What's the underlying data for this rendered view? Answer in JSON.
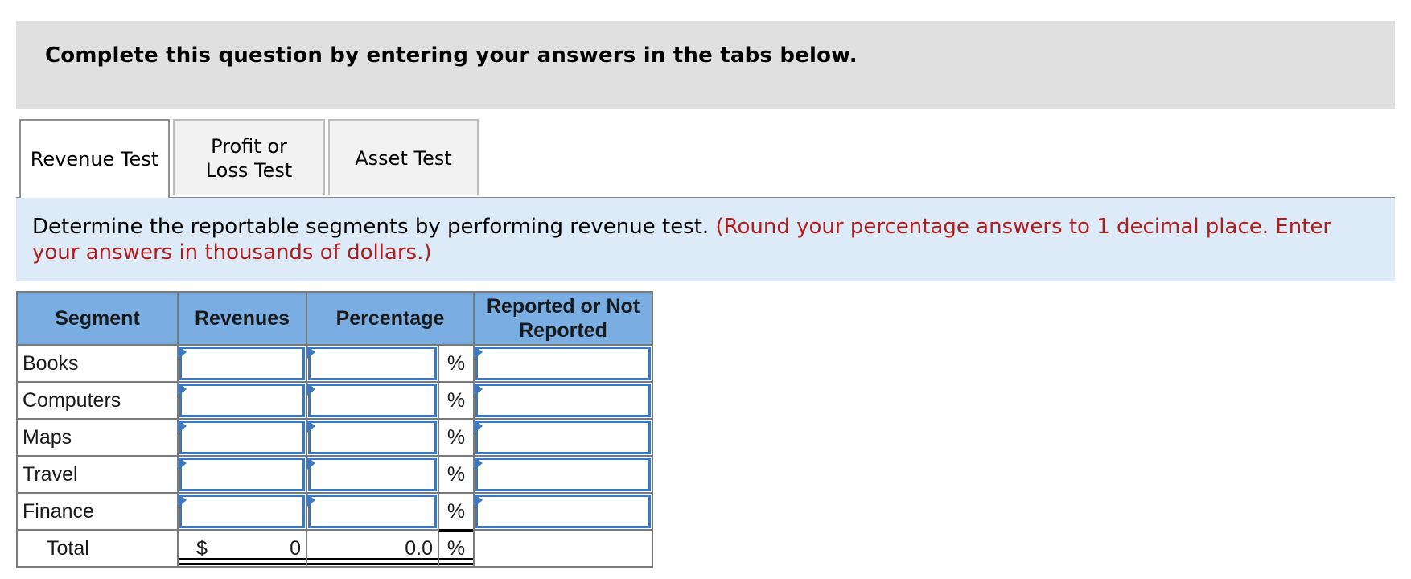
{
  "banner": {
    "text": "Complete this question by entering your answers in the tabs below."
  },
  "tabs": [
    {
      "label": "Revenue Test",
      "active": true
    },
    {
      "label": "Profit or Loss Test",
      "active": false
    },
    {
      "label": "Asset Test",
      "active": false
    }
  ],
  "instructions": {
    "main": "Determine the reportable segments by performing revenue test.",
    "note": "(Round your percentage answers to 1 decimal place. Enter your answers in thousands of dollars.)"
  },
  "table": {
    "headers": {
      "segment": "Segment",
      "revenues": "Revenues",
      "percentage": "Percentage",
      "reported": "Reported or Not Reported"
    },
    "percent_symbol": "%",
    "rows": [
      {
        "segment": "Books",
        "revenues": "",
        "percentage": "",
        "reported": ""
      },
      {
        "segment": "Computers",
        "revenues": "",
        "percentage": "",
        "reported": ""
      },
      {
        "segment": "Maps",
        "revenues": "",
        "percentage": "",
        "reported": ""
      },
      {
        "segment": "Travel",
        "revenues": "",
        "percentage": "",
        "reported": ""
      },
      {
        "segment": "Finance",
        "revenues": "",
        "percentage": "",
        "reported": ""
      }
    ],
    "total": {
      "label": "Total",
      "currency_symbol": "$",
      "revenues": "0",
      "percentage": "0.0"
    }
  }
}
